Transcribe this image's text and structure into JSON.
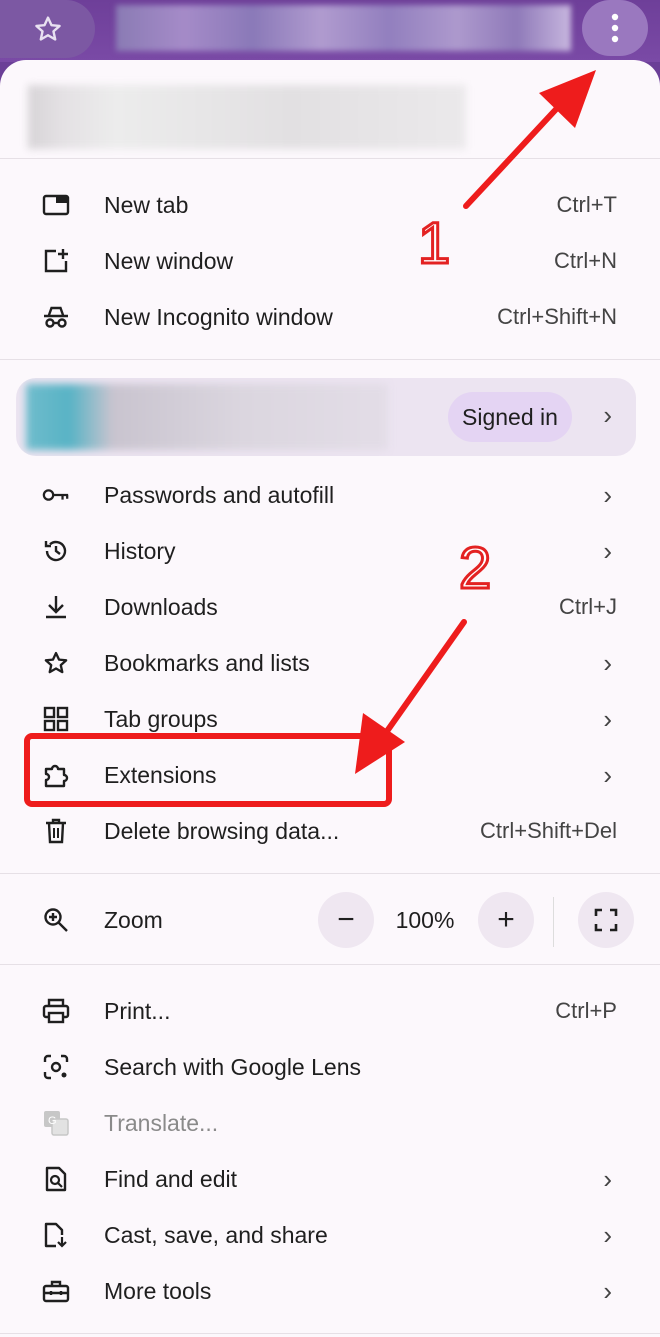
{
  "header": {
    "star_icon": "star-outline-icon",
    "menu_icon": "three-dot-menu-icon"
  },
  "menu_section1": [
    {
      "label": "New tab",
      "shortcut": "Ctrl+T",
      "icon": "new-tab-icon"
    },
    {
      "label": "New window",
      "shortcut": "Ctrl+N",
      "icon": "new-window-icon"
    },
    {
      "label": "New Incognito window",
      "shortcut": "Ctrl+Shift+N",
      "icon": "incognito-icon"
    }
  ],
  "profile": {
    "status": "Signed in"
  },
  "menu_section2": [
    {
      "label": "Passwords and autofill",
      "icon": "key-icon"
    },
    {
      "label": "History",
      "icon": "history-icon"
    },
    {
      "label": "Downloads",
      "shortcut": "Ctrl+J",
      "icon": "download-icon"
    },
    {
      "label": "Bookmarks and lists",
      "icon": "star-icon"
    },
    {
      "label": "Tab groups",
      "icon": "grid-icon"
    },
    {
      "label": "Extensions",
      "icon": "puzzle-icon"
    },
    {
      "label": "Delete browsing data...",
      "shortcut": "Ctrl+Shift+Del",
      "icon": "trash-icon"
    }
  ],
  "zoom": {
    "label": "Zoom",
    "value": "100%",
    "minus": "−",
    "plus": "+"
  },
  "menu_section3": [
    {
      "label": "Print...",
      "shortcut": "Ctrl+P",
      "icon": "print-icon"
    },
    {
      "label": "Search with Google Lens",
      "icon": "lens-icon"
    },
    {
      "label": "Translate...",
      "icon": "translate-icon",
      "disabled": true
    },
    {
      "label": "Find and edit",
      "icon": "find-icon"
    },
    {
      "label": "Cast, save, and share",
      "icon": "cast-icon"
    },
    {
      "label": "More tools",
      "icon": "toolbox-icon"
    }
  ],
  "annotations": {
    "step1": "1",
    "step2": "2",
    "highlight_color": "#ee1c1c"
  }
}
